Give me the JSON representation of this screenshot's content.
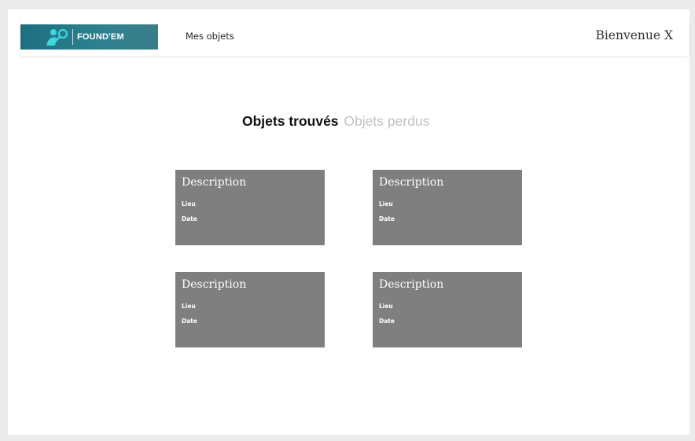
{
  "header": {
    "logo_text": "FOUND'EM",
    "nav_link": "Mes objets",
    "welcome": "Bienvenue X"
  },
  "tabs": [
    {
      "label": "Objets trouvés",
      "active": true
    },
    {
      "label": "Objets perdus",
      "active": false
    }
  ],
  "cards": [
    {
      "title": "Description",
      "lieu": "Lieu",
      "date": "Date"
    },
    {
      "title": "Description",
      "lieu": "Lieu",
      "date": "Date"
    },
    {
      "title": "Description",
      "lieu": "Lieu",
      "date": "Date"
    },
    {
      "title": "Description",
      "lieu": "Lieu",
      "date": "Date"
    }
  ],
  "colors": {
    "background": "#ebebeb",
    "logo_bg": "#2e8290",
    "card_bg": "#7f7f7f",
    "tab_inactive": "#c2c2c2"
  }
}
